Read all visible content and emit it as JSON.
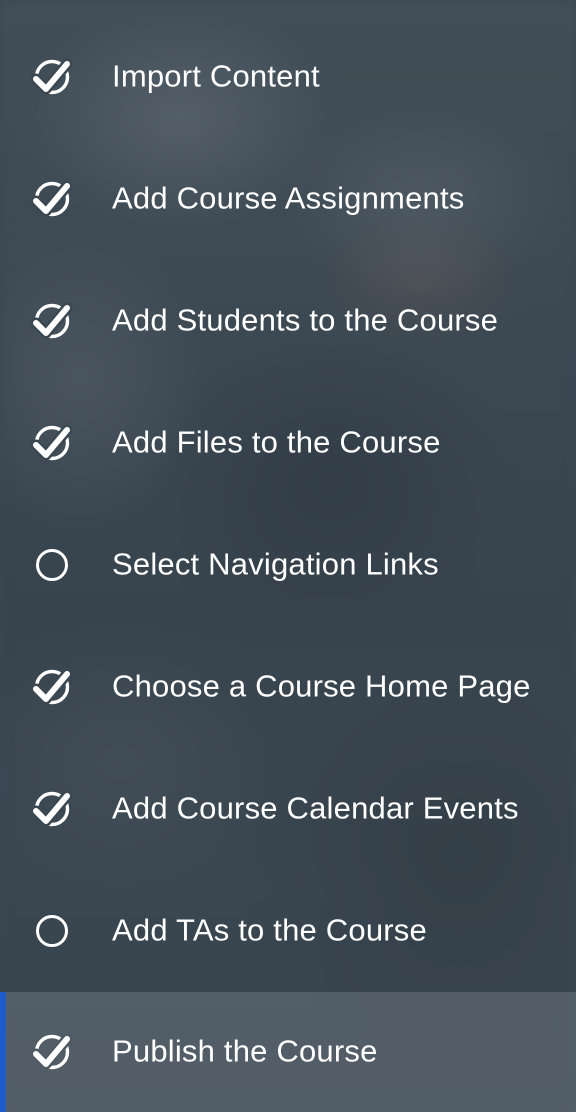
{
  "checklist": {
    "items": [
      {
        "label": "Import Content",
        "status": "complete",
        "icon": "check-circle-icon"
      },
      {
        "label": "Add Course Assignments",
        "status": "complete",
        "icon": "check-circle-icon"
      },
      {
        "label": "Add Students to the Course",
        "status": "complete",
        "icon": "check-circle-icon"
      },
      {
        "label": "Add Files to the Course",
        "status": "complete",
        "icon": "check-circle-icon"
      },
      {
        "label": "Select Navigation Links",
        "status": "incomplete",
        "icon": "empty-circle-icon"
      },
      {
        "label": "Choose a Course Home Page",
        "status": "complete",
        "icon": "check-circle-icon"
      },
      {
        "label": "Add Course Calendar Events",
        "status": "complete",
        "icon": "check-circle-icon"
      },
      {
        "label": "Add TAs to the Course",
        "status": "incomplete",
        "icon": "empty-circle-icon"
      },
      {
        "label": "Publish the Course",
        "status": "complete",
        "icon": "check-circle-icon",
        "selected": true
      }
    ],
    "colors": {
      "background": "#3b4751",
      "text": "#ffffff",
      "selected_accent": "#1d5cc9",
      "selected_background": "#4f5a64"
    }
  }
}
